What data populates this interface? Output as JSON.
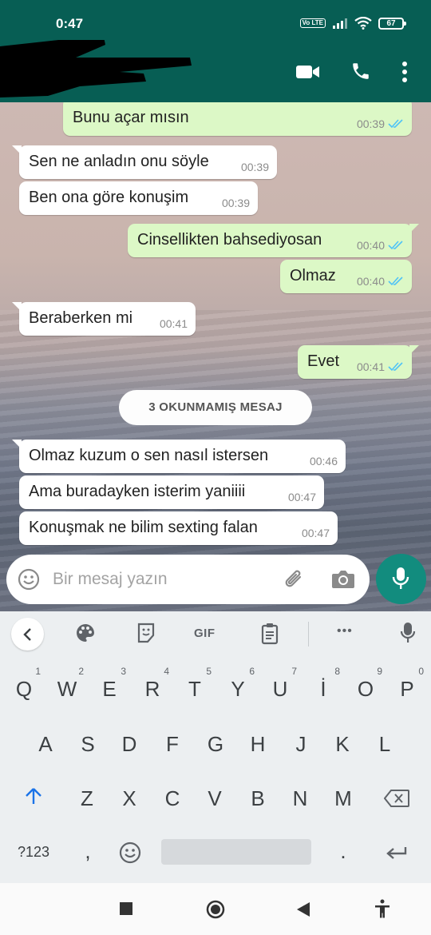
{
  "status_bar": {
    "time": "0:47",
    "volte": "Vo LTE",
    "battery": "67"
  },
  "app_bar": {
    "contact_name_redacted": true,
    "icons": [
      "video-call-icon",
      "voice-call-icon",
      "more-options-icon"
    ]
  },
  "chat": {
    "messages": [
      {
        "direction": "out",
        "text": "Bunu açar mısın",
        "time": "00:39",
        "read": true
      },
      {
        "direction": "in",
        "text": "Sen ne anladın onu söyle",
        "time": "00:39"
      },
      {
        "direction": "in",
        "text": "Ben ona göre konuşim",
        "time": "00:39"
      },
      {
        "direction": "out",
        "text": "Cinsellikten bahsediyosan",
        "time": "00:40",
        "read": true
      },
      {
        "direction": "out",
        "text": "Olmaz",
        "time": "00:40",
        "read": true
      },
      {
        "direction": "in",
        "text": "Beraberken mi",
        "time": "00:41"
      },
      {
        "direction": "out",
        "text": "Evet",
        "time": "00:41",
        "read": true
      },
      {
        "direction": "in",
        "text": "Olmaz kuzum o sen nasıl istersen",
        "time": "00:46"
      },
      {
        "direction": "in",
        "text": "Ama buradayken isterim yaniiii",
        "time": "00:47"
      },
      {
        "direction": "in",
        "text": "Konuşmak ne bilim sexting falan",
        "time": "00:47"
      }
    ],
    "unread_divider": "3 OKUNMAMIŞ MESAJ"
  },
  "composer": {
    "placeholder": "Bir mesaj yazın",
    "icons": [
      "emoji-icon",
      "attach-icon",
      "camera-icon",
      "mic-icon"
    ]
  },
  "keyboard": {
    "toolbar": {
      "gif_label": "GIF",
      "more": "•••"
    },
    "row1": [
      {
        "key": "Q",
        "num": "1"
      },
      {
        "key": "W",
        "num": "2"
      },
      {
        "key": "E",
        "num": "3"
      },
      {
        "key": "R",
        "num": "4"
      },
      {
        "key": "T",
        "num": "5"
      },
      {
        "key": "Y",
        "num": "6"
      },
      {
        "key": "U",
        "num": "7"
      },
      {
        "key": "İ",
        "num": "8"
      },
      {
        "key": "O",
        "num": "9"
      },
      {
        "key": "P",
        "num": "0"
      }
    ],
    "row2": [
      "A",
      "S",
      "D",
      "F",
      "G",
      "H",
      "J",
      "K",
      "L"
    ],
    "row3": [
      "Z",
      "X",
      "C",
      "V",
      "B",
      "N",
      "M"
    ],
    "symbols_label": "?123",
    "comma": ",",
    "period": "."
  },
  "colors": {
    "header": "#075e54",
    "outgoing_bubble": "#dcf8c6",
    "incoming_bubble": "#ffffff",
    "fab": "#128c7e",
    "read_ticks": "#4fc3f7"
  }
}
